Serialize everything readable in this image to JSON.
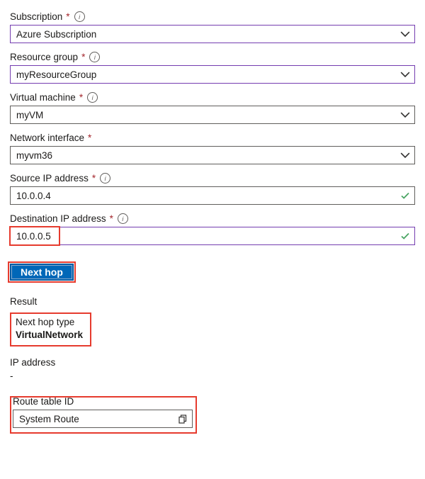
{
  "subscription": {
    "label": "Subscription",
    "required": "*",
    "value": "Azure Subscription"
  },
  "resource_group": {
    "label": "Resource group",
    "required": "*",
    "value": "myResourceGroup"
  },
  "vm": {
    "label": "Virtual machine",
    "required": "*",
    "value": "myVM"
  },
  "nic": {
    "label": "Network interface",
    "required": "*",
    "value": "myvm36"
  },
  "src_ip": {
    "label": "Source IP address",
    "required": "*",
    "value": "10.0.0.4"
  },
  "dst_ip": {
    "label": "Destination IP address",
    "required": "*",
    "value": "10.0.0.5"
  },
  "action": {
    "next_hop": "Next hop"
  },
  "result": {
    "heading": "Result",
    "next_hop_type_label": "Next hop type",
    "next_hop_type_value": "VirtualNetwork",
    "ip_label": "IP address",
    "ip_value": "-",
    "route_table_label": "Route table ID",
    "route_table_value": "System Route"
  },
  "icons": {
    "info": "i",
    "chevron_down": "chevron-down-icon",
    "check": "check-icon",
    "copy": "copy-icon"
  }
}
